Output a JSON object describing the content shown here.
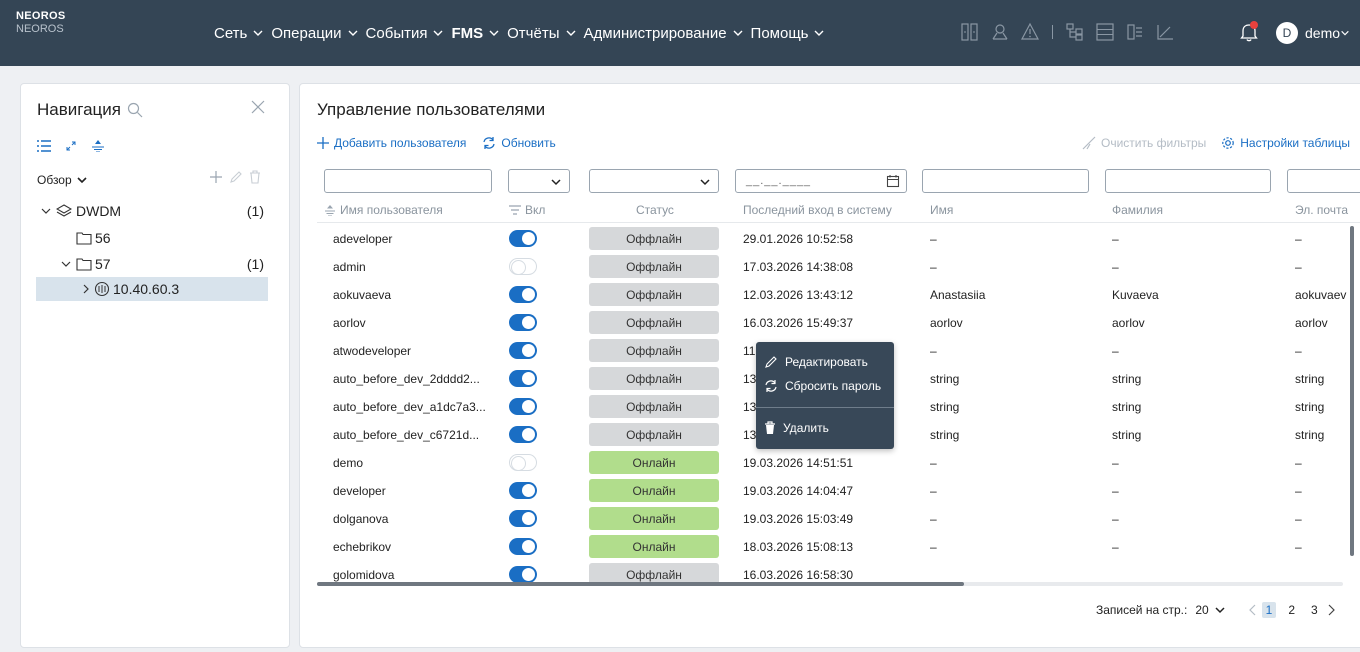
{
  "header": {
    "logo_line1": "NEOROS",
    "logo_line2": "NEOROS",
    "menu": [
      {
        "label": "Сеть"
      },
      {
        "label": "Операции"
      },
      {
        "label": "События"
      },
      {
        "label": "FMS"
      },
      {
        "label": "Отчёты"
      },
      {
        "label": "Администрирование"
      },
      {
        "label": "Помощь"
      }
    ],
    "avatar_letter": "D",
    "user_name": "demo"
  },
  "navigation": {
    "title": "Навигация",
    "overview_label": "Обзор",
    "tree": [
      {
        "label": "DWDM",
        "count": "(1)"
      },
      {
        "label": "56",
        "count": ""
      },
      {
        "label": "57",
        "count": "(1)"
      },
      {
        "label": "10.40.60.3",
        "count": ""
      }
    ]
  },
  "main": {
    "title": "Управление пользователями",
    "add_user_label": "Добавить пользователя",
    "refresh_label": "Обновить",
    "clear_filters_label": "Очистить фильтры",
    "table_settings_label": "Настройки таблицы",
    "date_placeholder": "__.__.____",
    "columns": {
      "username": "Имя пользователя",
      "enabled": "Вкл",
      "status": "Статус",
      "last_login": "Последний вход в систему",
      "first_name": "Имя",
      "last_name": "Фамилия",
      "email": "Эл. почта"
    },
    "rows": [
      {
        "username": "adeveloper",
        "enabled": true,
        "status": "Оффлайн",
        "online": false,
        "last_login": "29.01.2026 10:52:58",
        "first_name": "–",
        "last_name": "–",
        "email": "–"
      },
      {
        "username": "admin",
        "enabled": false,
        "status": "Оффлайн",
        "online": false,
        "last_login": "17.03.2026 14:38:08",
        "first_name": "–",
        "last_name": "–",
        "email": "–"
      },
      {
        "username": "aokuvaeva",
        "enabled": true,
        "status": "Оффлайн",
        "online": false,
        "last_login": "12.03.2026 13:43:12",
        "first_name": "Anastasiia",
        "last_name": "Kuvaeva",
        "email": "aokuvaev"
      },
      {
        "username": "aorlov",
        "enabled": true,
        "status": "Оффлайн",
        "online": false,
        "last_login": "16.03.2026 15:49:37",
        "first_name": "aorlov",
        "last_name": "aorlov",
        "email": "aorlov"
      },
      {
        "username": "atwodeveloper",
        "enabled": true,
        "status": "Оффлайн",
        "online": false,
        "last_login": "11",
        "first_name": "–",
        "last_name": "–",
        "email": "–"
      },
      {
        "username": "auto_before_dev_2dddd2...",
        "enabled": true,
        "status": "Оффлайн",
        "online": false,
        "last_login": "13",
        "first_name": "string",
        "last_name": "string",
        "email": "string"
      },
      {
        "username": "auto_before_dev_a1dc7a3...",
        "enabled": true,
        "status": "Оффлайн",
        "online": false,
        "last_login": "13",
        "first_name": "string",
        "last_name": "string",
        "email": "string"
      },
      {
        "username": "auto_before_dev_c6721d...",
        "enabled": true,
        "status": "Оффлайн",
        "online": false,
        "last_login": "13",
        "first_name": "string",
        "last_name": "string",
        "email": "string"
      },
      {
        "username": "demo",
        "enabled": false,
        "status": "Онлайн",
        "online": true,
        "last_login": "19.03.2026 14:51:51",
        "first_name": "–",
        "last_name": "–",
        "email": "–"
      },
      {
        "username": "developer",
        "enabled": true,
        "status": "Онлайн",
        "online": true,
        "last_login": "19.03.2026 14:04:47",
        "first_name": "–",
        "last_name": "–",
        "email": "–"
      },
      {
        "username": "dolganova",
        "enabled": true,
        "status": "Онлайн",
        "online": true,
        "last_login": "19.03.2026 15:03:49",
        "first_name": "–",
        "last_name": "–",
        "email": "–"
      },
      {
        "username": "echebrikov",
        "enabled": true,
        "status": "Онлайн",
        "online": true,
        "last_login": "18.03.2026 15:08:13",
        "first_name": "–",
        "last_name": "–",
        "email": "–"
      },
      {
        "username": "golomidova",
        "enabled": true,
        "status": "Оффлайн",
        "online": false,
        "last_login": "16.03.2026 16:58:30",
        "first_name": "",
        "last_name": "",
        "email": ""
      }
    ],
    "pagination": {
      "per_page_label": "Записей на стр.:",
      "per_page": "20",
      "pages": [
        "1",
        "2",
        "3"
      ],
      "current": "1"
    }
  },
  "context_menu": {
    "edit": "Редактировать",
    "reset_password": "Сбросить пароль",
    "delete": "Удалить"
  },
  "colors": {
    "header_bg": "#344555",
    "accent": "#1a6ec4",
    "online": "#b1dd8c",
    "offline": "#d6d8da",
    "notification": "#e8413d"
  }
}
